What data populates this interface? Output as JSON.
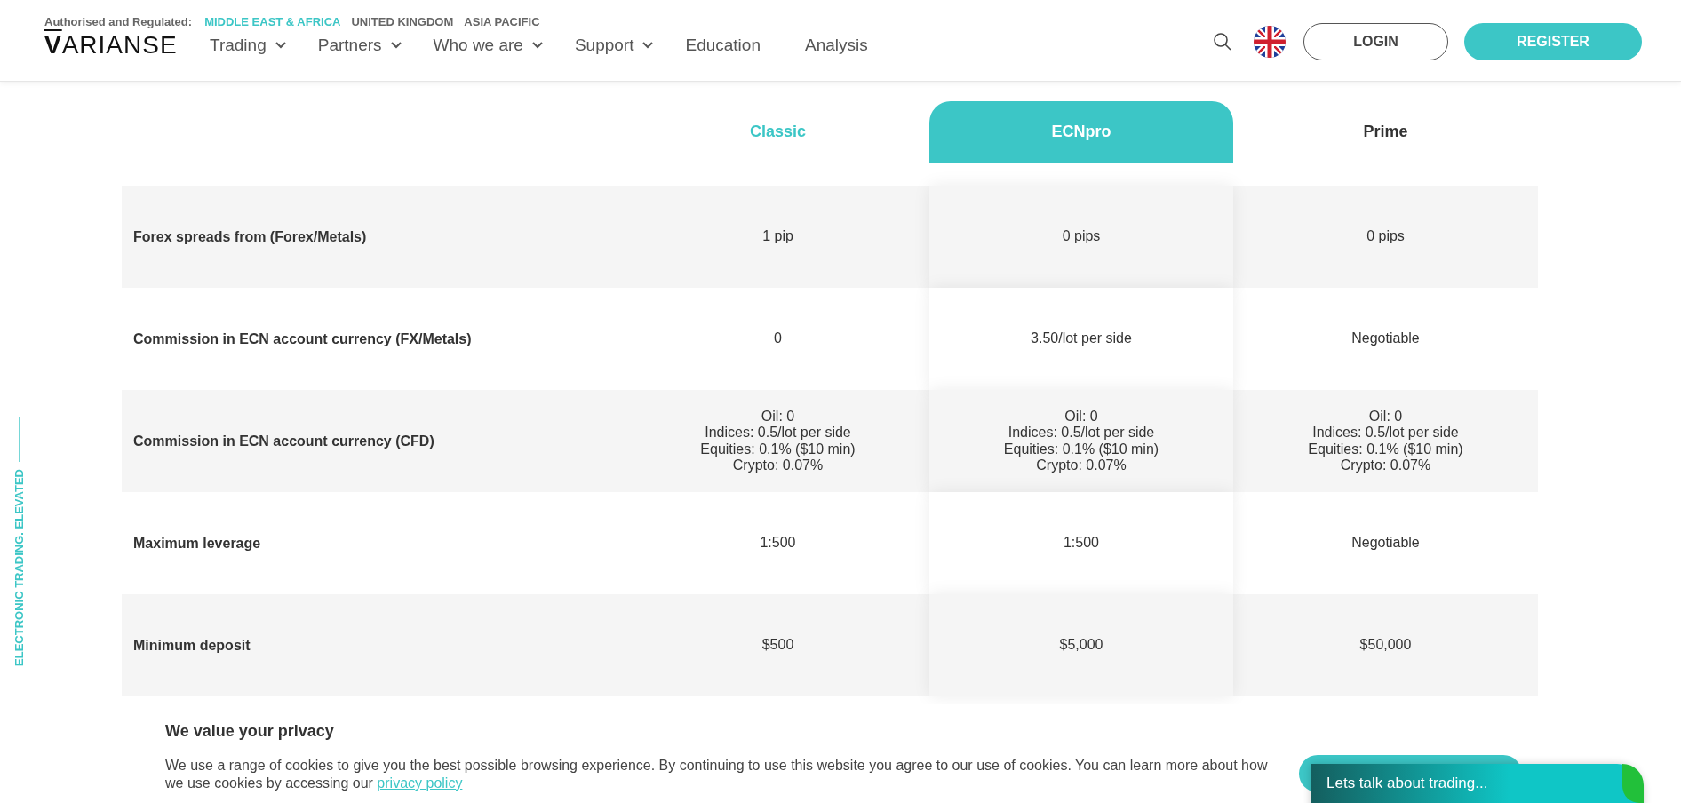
{
  "regulation": {
    "label": "Authorised and Regulated:",
    "regions": [
      {
        "label": "MIDDLE EAST & AFRICA",
        "selected": true
      },
      {
        "label": "UNITED KINGDOM",
        "selected": false
      },
      {
        "label": "ASIA PACIFIC",
        "selected": false
      }
    ]
  },
  "logo": {
    "mark": "V",
    "rest": "ARIANSE"
  },
  "nav": [
    {
      "label": "Trading",
      "dropdown": true
    },
    {
      "label": "Partners",
      "dropdown": true
    },
    {
      "label": "Who we are",
      "dropdown": true
    },
    {
      "label": "Support",
      "dropdown": true
    },
    {
      "label": "Education",
      "dropdown": false
    },
    {
      "label": "Analysis",
      "dropdown": false
    }
  ],
  "actions": {
    "login": "LOGIN",
    "register": "REGISTER"
  },
  "side_tagline": "ELECTRONIC TRADING. ELEVATED",
  "plans": [
    {
      "name": "Classic",
      "selected": false,
      "color": "#3cc6c6"
    },
    {
      "name": "ECNpro",
      "selected": true,
      "color": "#ffffff"
    },
    {
      "name": "Prime",
      "selected": false,
      "color": "#333333"
    }
  ],
  "rows": [
    {
      "label": "Forex spreads from (Forex/Metals)",
      "values": [
        [
          "1 pip"
        ],
        [
          "0 pips"
        ],
        [
          "0 pips"
        ]
      ]
    },
    {
      "label": "Commission in ECN account currency (FX/Metals)",
      "values": [
        [
          "0"
        ],
        [
          "3.50/lot per side"
        ],
        [
          "Negotiable"
        ]
      ]
    },
    {
      "label": "Commission in ECN account currency (CFD)",
      "values": [
        [
          "Oil: 0",
          "Indices: 0.5/lot per side",
          "Equities: 0.1% ($10 min)",
          "Crypto: 0.07%"
        ],
        [
          "Oil: 0",
          "Indices: 0.5/lot per side",
          "Equities: 0.1% ($10 min)",
          "Crypto: 0.07%"
        ],
        [
          "Oil: 0",
          "Indices: 0.5/lot per side",
          "Equities: 0.1% ($10 min)",
          "Crypto: 0.07%"
        ]
      ]
    },
    {
      "label": "Maximum leverage",
      "values": [
        [
          "1:500"
        ],
        [
          "1:500"
        ],
        [
          "Negotiable"
        ]
      ]
    },
    {
      "label": "Minimum deposit",
      "values": [
        [
          "$500"
        ],
        [
          "$5,000"
        ],
        [
          "$50,000"
        ]
      ]
    }
  ],
  "cookie": {
    "title": "We value your privacy",
    "text": "We use a range of cookies to give you the best possible browsing experience. By continuing to use this website you agree to our use of cookies. You can learn more about how we use cookies by accessing our",
    "link": "privacy policy"
  },
  "chat": {
    "label": "Lets talk about trading..."
  }
}
